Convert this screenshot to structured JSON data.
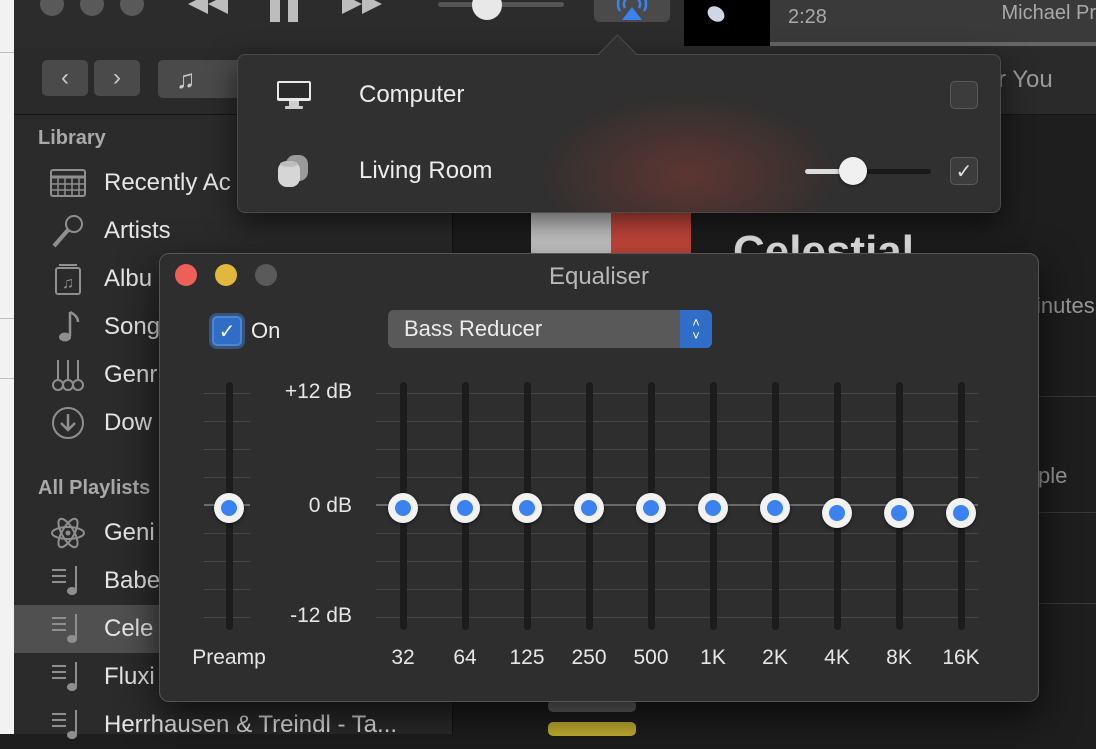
{
  "player": {
    "time_elapsed": "2:28",
    "artist": "Michael Pr"
  },
  "nav": {
    "tab_partial": "r You"
  },
  "sidebar": {
    "library_heading": "Library",
    "library_items": [
      {
        "label": "Recently Ac",
        "icon": "calendar-grid-icon"
      },
      {
        "label": "Artists",
        "icon": "microphone-icon"
      },
      {
        "label": "Albu",
        "icon": "album-icon"
      },
      {
        "label": "Song",
        "icon": "music-note-icon"
      },
      {
        "label": "Genr",
        "icon": "guitars-icon"
      },
      {
        "label": "Dow",
        "icon": "download-icon"
      }
    ],
    "playlists_heading": "All Playlists",
    "playlist_items": [
      {
        "label": "Geni",
        "icon": "genius-atom-icon"
      },
      {
        "label": "Babe",
        "icon": "playlist-icon"
      },
      {
        "label": "Cele",
        "icon": "playlist-icon",
        "selected": true
      },
      {
        "label": "Fluxi",
        "icon": "playlist-icon"
      },
      {
        "label": "Herrhausen & Treindl - Ta...",
        "icon": "playlist-icon"
      }
    ]
  },
  "main": {
    "album_title": "Celestial",
    "side_text_1": "inutes",
    "side_text_2": "ple"
  },
  "airplay": {
    "devices": [
      {
        "label": "Computer",
        "icon": "monitor-icon",
        "checked": false
      },
      {
        "label": "Living Room",
        "icon": "homepod-icon",
        "checked": true,
        "volume": 0.38
      }
    ]
  },
  "equaliser": {
    "title": "Equaliser",
    "on_label": "On",
    "on_checked": true,
    "preset": "Bass Reducer",
    "db_labels": {
      "top": "+12 dB",
      "mid": "0 dB",
      "bottom": "-12 dB"
    },
    "preamp": {
      "label": "Preamp",
      "db": 0
    },
    "bands": [
      {
        "label": "32",
        "db": 0
      },
      {
        "label": "64",
        "db": 0
      },
      {
        "label": "125",
        "db": 0
      },
      {
        "label": "250",
        "db": 0
      },
      {
        "label": "500",
        "db": 0
      },
      {
        "label": "1K",
        "db": 0
      },
      {
        "label": "2K",
        "db": 0
      },
      {
        "label": "4K",
        "db": -0.5
      },
      {
        "label": "8K",
        "db": -0.5
      },
      {
        "label": "16K",
        "db": -0.5
      }
    ],
    "colors": {
      "accent": "#3b82f0",
      "close": "#ed5f57",
      "minimize": "#e1b83c",
      "zoom": "#5a5a5a"
    }
  }
}
